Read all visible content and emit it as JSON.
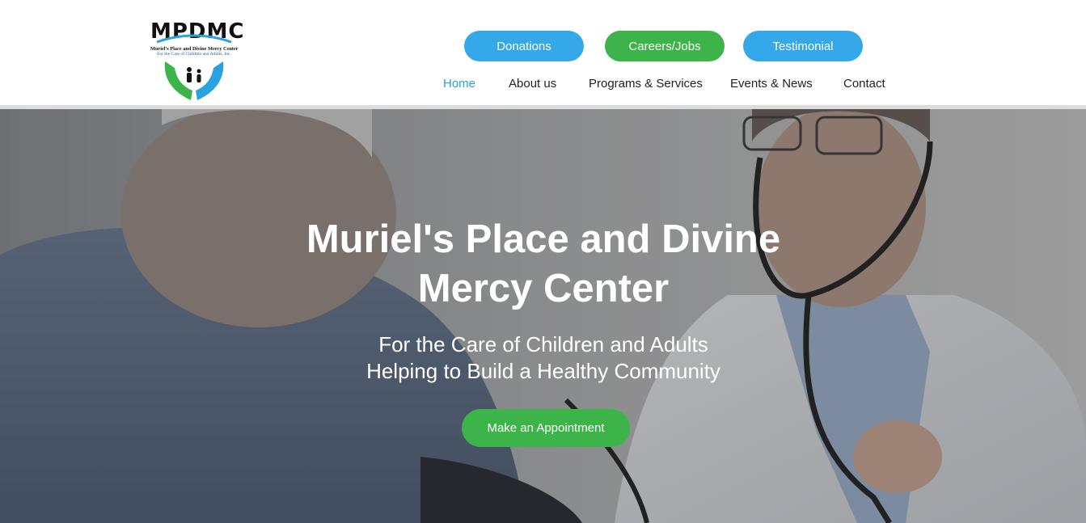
{
  "logo": {
    "acronym": "MPDMC",
    "name_line": "Muriel's Place and Divine Mercy Center",
    "tagline_line": "For the Care of Children and Adults, Inc."
  },
  "header_buttons": {
    "donations": "Donations",
    "careers": "Careers/Jobs",
    "testimonial": "Testimonial"
  },
  "nav": {
    "items": [
      "Home",
      "About us",
      "Programs & Services",
      "Events & News",
      "Contact"
    ],
    "active": "Home"
  },
  "hero": {
    "title_line1": "Muriel's Place and Divine",
    "title_line2": "Mercy Center",
    "subtitle_line1": "For the Care of Children and Adults",
    "subtitle_line2": "Helping to Build a Healthy Community",
    "cta_label": "Make an Appointment"
  },
  "colors": {
    "blue": "#34a8e8",
    "green": "#3cb449",
    "nav_active": "#2a9fd8"
  }
}
